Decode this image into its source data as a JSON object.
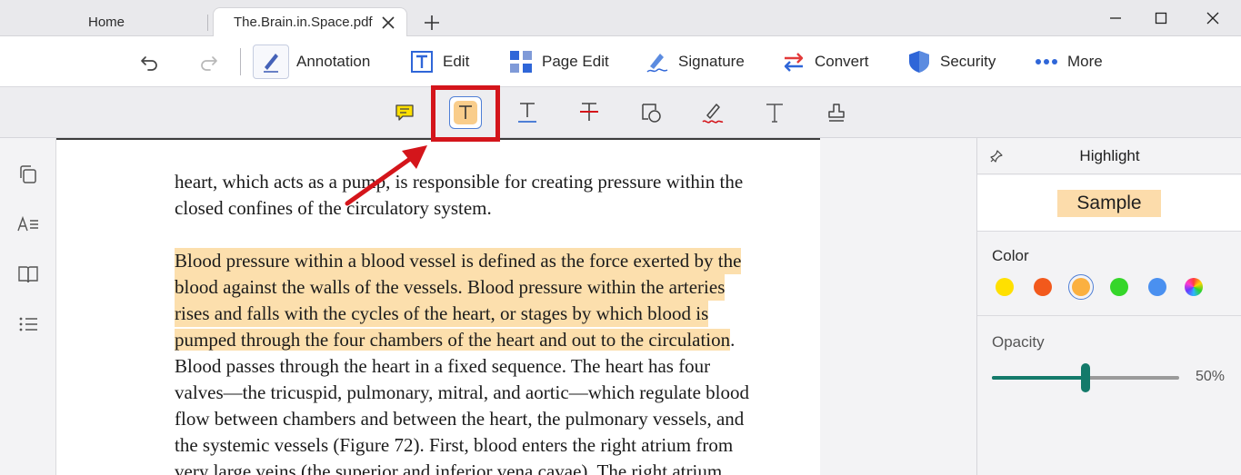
{
  "tabs": [
    {
      "label": "Home"
    },
    {
      "label": "The.Brain.in.Space.pdf"
    }
  ],
  "toolbar": {
    "annotation": "Annotation",
    "edit": "Edit",
    "page_edit": "Page Edit",
    "signature": "Signature",
    "convert": "Convert",
    "security": "Security",
    "more": "More"
  },
  "document": {
    "lines": [
      "heart, which acts as a pump, is responsible for creating pressure within the",
      "closed confines of the circulatory system.",
      "Blood pressure within a blood vessel is defined as the force exerted by the",
      "blood against the walls of the vessels. Blood pressure within the arteries",
      "rises and falls with the cycles of the heart, or stages by which blood is",
      "pumped through the four chambers of the heart and out to the circulation",
      ".",
      "Blood passes through the heart in a fixed sequence. The heart has four",
      "valves—the tricuspid, pulmonary, mitral, and aortic—which regulate blood",
      "flow between chambers and between the heart, the pulmonary vessels, and",
      "the systemic vessels (Figure 72). First, blood enters the right atrium from",
      "very large veins (the superior and inferior vena cavae). The right atrium"
    ]
  },
  "panel": {
    "title": "Highlight",
    "sample": "Sample",
    "color_label": "Color",
    "opacity_label": "Opacity",
    "opacity_value": "50%",
    "opacity_fraction": 0.5,
    "colors": [
      "#ffe000",
      "#f2591c",
      "#fbb040",
      "#35d62a",
      "#4a90f0",
      "rainbow"
    ],
    "selected_color_index": 2
  },
  "icons": {
    "highlight_color": "#f9cd8b",
    "accent": "#4f7fd6",
    "slider": "#137a6a",
    "callout": "#d4151b"
  }
}
